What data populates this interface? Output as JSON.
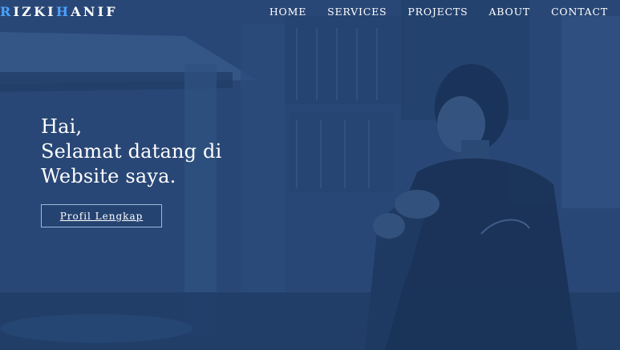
{
  "nav": {
    "brand": {
      "first_letter": "R",
      "part_one_rest": "IZKI",
      "middle_letter": "H",
      "part_two_rest": "ANIF"
    },
    "links": [
      {
        "label": "HOME"
      },
      {
        "label": "SERVICES"
      },
      {
        "label": "PROJECTS"
      },
      {
        "label": "ABOUT"
      },
      {
        "label": "CONTACT"
      }
    ]
  },
  "hero": {
    "lines": [
      "Hai,",
      "Selamat datang di",
      "Website saya."
    ],
    "cta_label": "Profil Lengkap"
  },
  "colors": {
    "overlay_blue": "#24426f",
    "brand_accent": "#4aa3ff",
    "button_border": "#b4e6ff"
  },
  "icons": {
    "hero_photo": "person-in-jacket-photo"
  }
}
